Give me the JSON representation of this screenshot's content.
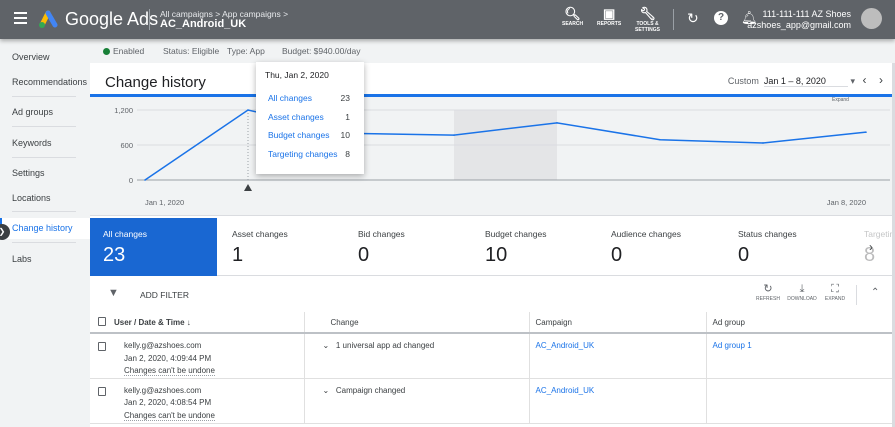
{
  "topbar": {
    "brand": "Google Ads",
    "breadcrumb_1": "All campaigns",
    "breadcrumb_2": "App campaigns",
    "campaign": "AC_Android_UK",
    "search": "SEARCH",
    "reports": "REPORTS",
    "tools": "TOOLS &",
    "tools2": "SETTINGS",
    "account_id": "111-111-111 AZ Shoes",
    "account_email": "azshoes_app@gmail.com"
  },
  "sidebar": {
    "items": [
      "Overview",
      "Recommendations",
      "Ad groups",
      "Keywords",
      "Settings",
      "Locations",
      "Change history",
      "Labs"
    ],
    "active": "Change history"
  },
  "status": {
    "enabled": "Enabled",
    "status": "Status: Eligible",
    "type": "Type: App",
    "budget": "Budget: $940.00/day"
  },
  "panel": {
    "title": "Change history",
    "date_label": "Custom",
    "date_range": "Jan 1 – 8, 2020",
    "expand": "Expand"
  },
  "tooltip": {
    "date": "Thu, Jan 2, 2020",
    "rows": [
      {
        "label": "All changes",
        "value": "23"
      },
      {
        "label": "Asset changes",
        "value": "1"
      },
      {
        "label": "Budget changes",
        "value": "10"
      },
      {
        "label": "Targeting changes",
        "value": "8"
      }
    ]
  },
  "chart_data": {
    "type": "line",
    "x": [
      "Jan 1, 2020",
      "Jan 2, 2020",
      "Jan 3, 2020",
      "Jan 4, 2020",
      "Jan 5, 2020",
      "Jan 6, 2020",
      "Jan 7, 2020",
      "Jan 8, 2020"
    ],
    "y": [
      0,
      1200,
      800,
      770,
      980,
      690,
      635,
      820
    ],
    "ylim": [
      0,
      1200
    ],
    "yticks": [
      "0",
      "600",
      "1,200"
    ],
    "xtick_labels": [
      "Jan 1, 2020",
      "Jan 8, 2020"
    ],
    "grid": true,
    "color": "#1a73e8",
    "highlighted_range": [
      "Jan 4, 2020",
      "Jan 5, 2020"
    ],
    "selected": "Jan 2, 2020"
  },
  "metrics": [
    {
      "label": "All changes",
      "value": "23"
    },
    {
      "label": "Asset changes",
      "value": "1"
    },
    {
      "label": "Bid changes",
      "value": "0"
    },
    {
      "label": "Budget changes",
      "value": "10"
    },
    {
      "label": "Audience changes",
      "value": "0"
    },
    {
      "label": "Status changes",
      "value": "0"
    },
    {
      "label": "Targeting",
      "value": "8"
    }
  ],
  "toolbar": {
    "add_filter": "ADD FILTER",
    "refresh": "REFRESH",
    "download": "DOWNLOAD",
    "expand": "EXPAND"
  },
  "table": {
    "headers": [
      "User / Date & Time",
      "Change",
      "Campaign",
      "Ad group"
    ],
    "rows": [
      {
        "user": "kelly.g@azshoes.com",
        "datetime": "Jan 2, 2020, 4:09:44 PM",
        "note": "Changes can't be undone",
        "change": "1 universal app ad changed",
        "campaign": "AC_Android_UK",
        "ad_group": "Ad group 1"
      },
      {
        "user": "kelly.g@azshoes.com",
        "datetime": "Jan 2, 2020, 4:08:54 PM",
        "note": "Changes can't be undone",
        "change": "Campaign changed",
        "campaign": "AC_Android_UK",
        "ad_group": ""
      }
    ]
  }
}
